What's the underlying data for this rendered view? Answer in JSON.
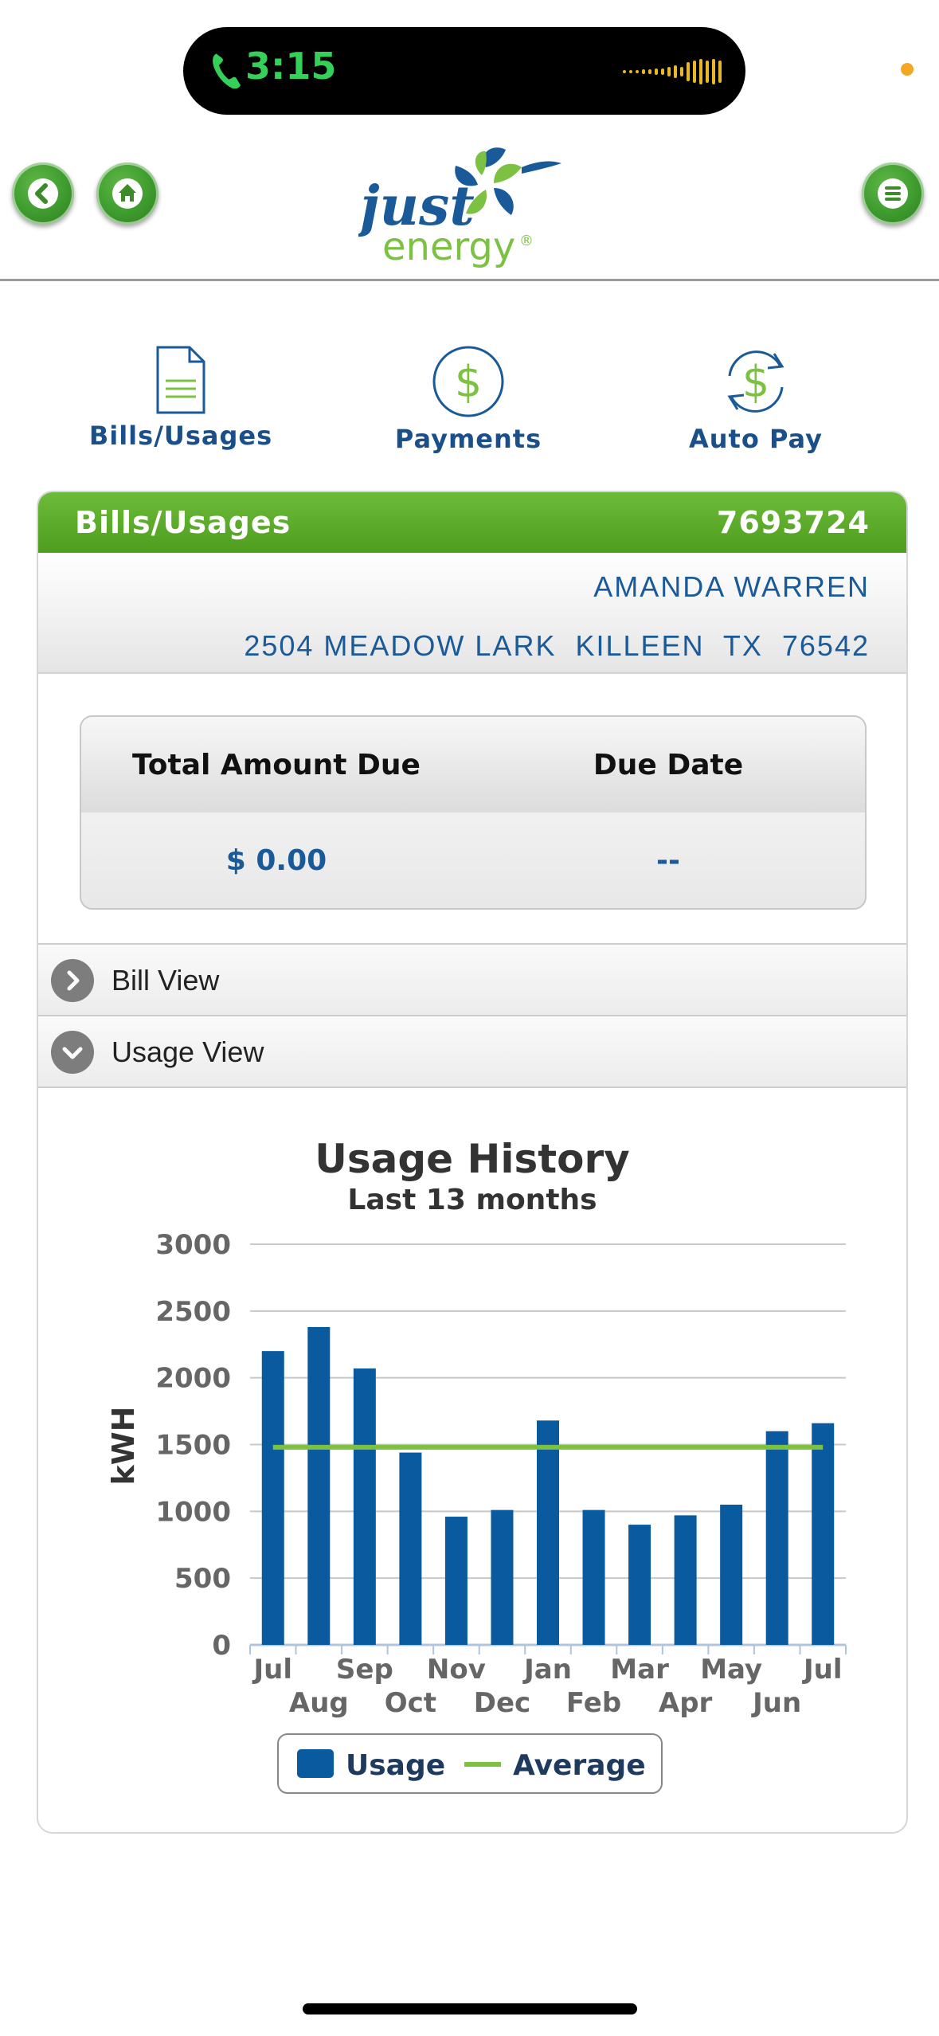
{
  "status_bar": {
    "call_time": "3:15"
  },
  "header": {
    "back_icon": "chevron-left-icon",
    "home_icon": "home-icon",
    "menu_icon": "hamburger-menu-icon",
    "logo_text_top": "just",
    "logo_text_bottom": "energy",
    "logo_mark": "®"
  },
  "quick_links": [
    {
      "label": "Bills/Usages",
      "icon": "document-icon"
    },
    {
      "label": "Payments",
      "icon": "dollar-circle-icon"
    },
    {
      "label": "Auto Pay",
      "icon": "dollar-refresh-icon"
    }
  ],
  "card": {
    "title": "Bills/Usages",
    "account_number": "7693724",
    "customer_name": "AMANDA WARREN",
    "address": "2504 MEADOW LARK  KILLEEN  TX  76542"
  },
  "amount_due": {
    "amount_label": "Total Amount Due",
    "date_label": "Due Date",
    "amount_value": "$ 0.00",
    "date_value": "--"
  },
  "accordion": [
    {
      "label": "Bill View",
      "state": "collapsed"
    },
    {
      "label": "Usage View",
      "state": "expanded"
    }
  ],
  "colors": {
    "brand_green": "#5aa82a",
    "brand_blue": "#1a5a99",
    "bar_blue": "#0a5aa0",
    "average_green": "#7cc142"
  },
  "chart_data": {
    "type": "bar",
    "title": "Usage History",
    "subtitle": "Last 13 months",
    "ylabel": "kWH",
    "xlabel": "",
    "ylim": [
      0,
      3000
    ],
    "yticks": [
      0,
      500,
      1000,
      1500,
      2000,
      2500,
      3000
    ],
    "grid": true,
    "legend_placement": "bottom",
    "categories": [
      "Jul",
      "Aug",
      "Sep",
      "Oct",
      "Nov",
      "Dec",
      "Jan",
      "Feb",
      "Mar",
      "Apr",
      "May",
      "Jun",
      "Jul"
    ],
    "series": [
      {
        "name": "Usage",
        "type": "bar",
        "values": [
          2200,
          2380,
          2070,
          1440,
          960,
          1010,
          1680,
          1010,
          900,
          970,
          1050,
          1600,
          1660
        ]
      },
      {
        "name": "Average",
        "type": "line",
        "value": 1480
      }
    ]
  }
}
